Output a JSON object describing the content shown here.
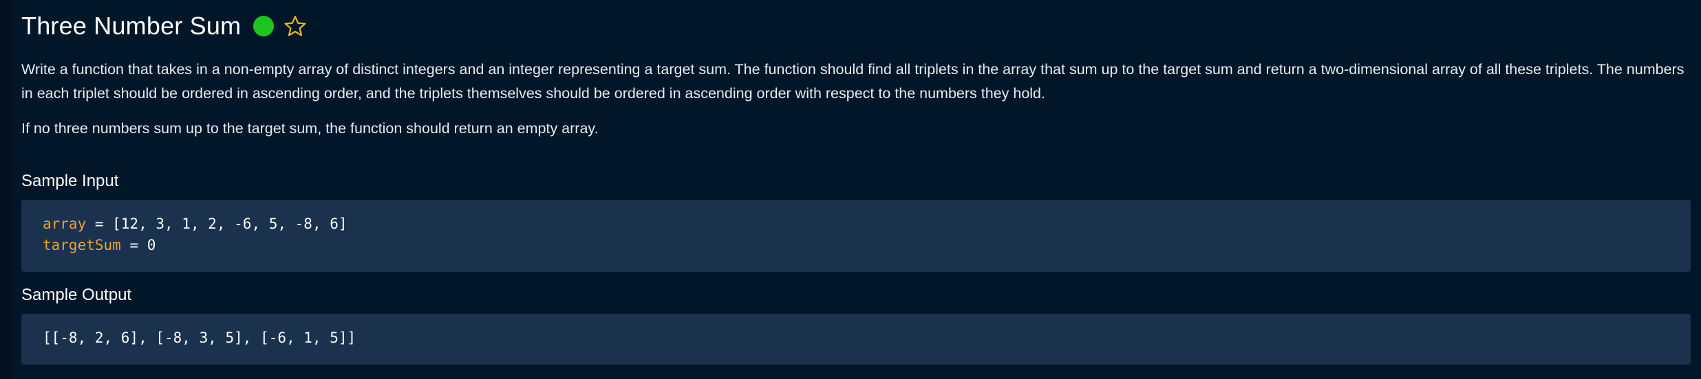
{
  "problem": {
    "title": "Three Number Sum",
    "difficulty_color": "#1ec51e",
    "favorite_icon": "star-outline-icon",
    "description_p1": "Write a function that takes in a non-empty array of distinct integers and an integer representing a target sum. The function should find all triplets in the array that sum up to the target sum and return a two-dimensional array of all these triplets. The numbers in each triplet should be ordered in ascending order, and the triplets themselves should be ordered in ascending order with respect to the numbers they hold.",
    "description_p2": "If no three numbers sum up to the target sum, the function should return an empty array."
  },
  "sample_input": {
    "heading": "Sample Input",
    "lines": [
      {
        "name": "array",
        "op": " = ",
        "value": "[12, 3, 1, 2, -6, 5, -8, 6]"
      },
      {
        "name": "targetSum",
        "op": " = ",
        "value": "0"
      }
    ]
  },
  "sample_output": {
    "heading": "Sample Output",
    "value": "[[-8, 2, 6], [-8, 3, 5], [-6, 1, 5]]"
  },
  "colors": {
    "background": "#011629",
    "code_background": "#1a324d",
    "variable_highlight": "#f0a030"
  }
}
